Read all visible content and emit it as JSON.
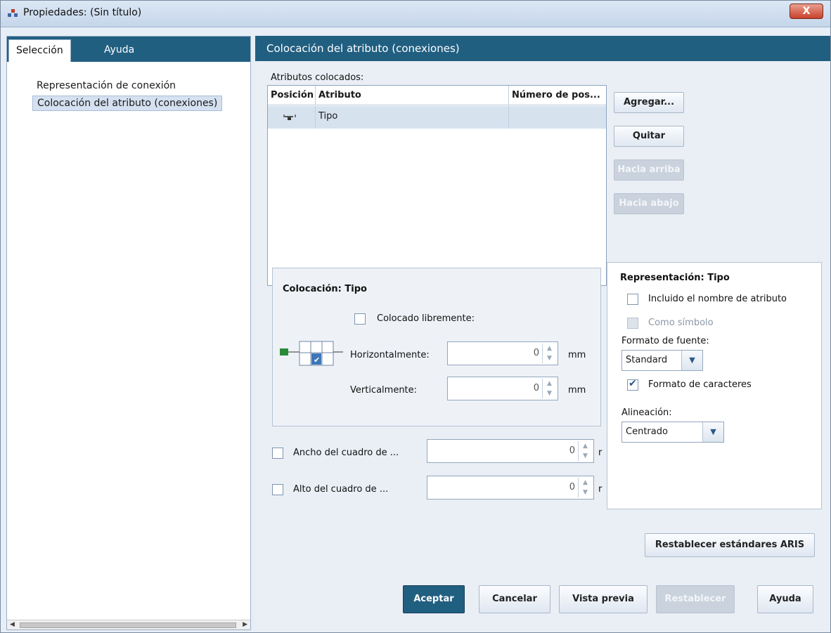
{
  "window": {
    "title": "Propiedades: (Sin título)",
    "close": "X"
  },
  "left": {
    "tabs": [
      "Selección",
      "Ayuda"
    ],
    "tree": [
      "Representación de conexión",
      "Colocación del atributo (conexiones)"
    ]
  },
  "right": {
    "header": "Colocación del atributo (conexiones)",
    "attrs_label": "Atributos colocados:",
    "table": {
      "columns": [
        "Posición",
        "Atributo",
        "Número de pos..."
      ],
      "rows": [
        {
          "position": "",
          "attribute": "Tipo",
          "number": ""
        }
      ]
    },
    "side_buttons": {
      "add": "Agregar...",
      "remove": "Quitar",
      "up": "Hacia arriba",
      "down": "Hacia abajo"
    },
    "placement": {
      "title": "Colocación: Tipo",
      "free_label": "Colocado libremente:",
      "h_label": "Horizontalmente:",
      "h_value": "0",
      "v_label": "Verticalmente:",
      "v_value": "0",
      "unit": "mm"
    },
    "width_label": "Ancho del cuadro de ...",
    "width_value": "0",
    "height_label": "Alto del cuadro de ...",
    "height_value": "0",
    "truncated_unit": "r",
    "representation": {
      "title": "Representación: Tipo",
      "include_name": "Incluido el nombre de atributo",
      "as_symbol": "Como símbolo",
      "font_format_label": "Formato de fuente:",
      "font_format_value": "Standard",
      "char_format": "Formato de caracteres",
      "alignment_label": "Alineación:",
      "alignment_value": "Centrado"
    },
    "reset_aris": "Restablecer estándares ARIS",
    "footer": {
      "ok": "Aceptar",
      "cancel": "Cancelar",
      "preview": "Vista previa",
      "reset": "Restablecer",
      "help": "Ayuda"
    }
  }
}
